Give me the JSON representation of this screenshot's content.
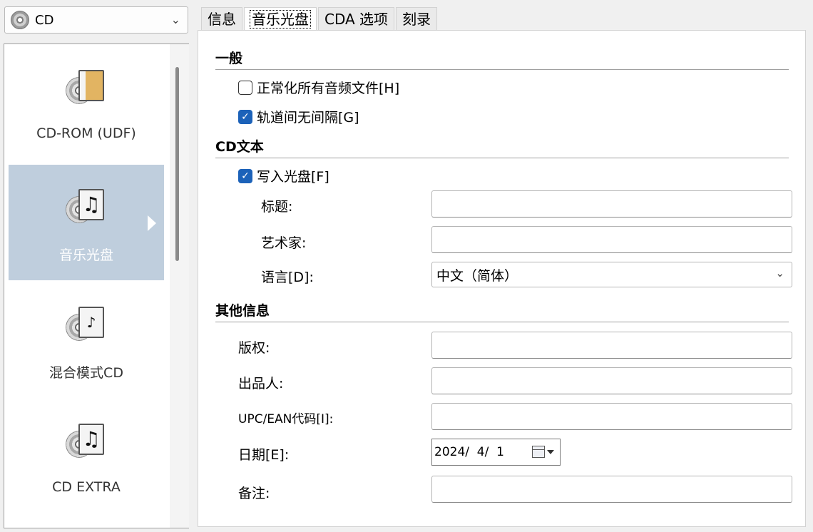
{
  "disc_select": {
    "value": "CD",
    "icon": "cd-disc-icon"
  },
  "categories": [
    {
      "label": "CD-ROM (UDF)",
      "icon": "cd-folder-icon",
      "selected": false
    },
    {
      "label": "音乐光盘",
      "icon": "cd-music-icon",
      "selected": true
    },
    {
      "label": "混合模式CD",
      "icon": "cd-mixed-icon",
      "selected": false
    },
    {
      "label": "CD EXTRA",
      "icon": "cd-extra-icon",
      "selected": false
    }
  ],
  "tabs": [
    "信息",
    "音乐光盘",
    "CDA 选项",
    "刻录"
  ],
  "active_tab": "音乐光盘",
  "general": {
    "title": "一般",
    "normalize_label": "正常化所有音频文件[H]",
    "normalize_checked": false,
    "gapless_label": "轨道间无间隔[G]",
    "gapless_checked": true
  },
  "cdtext": {
    "title": "CD文本",
    "write_label": "写入光盘[F]",
    "write_checked": true,
    "title_label": "标题:",
    "title_value": "",
    "artist_label": "艺术家:",
    "artist_value": "",
    "language_label": "语言[D]:",
    "language_value": "中文（简体）"
  },
  "other": {
    "title": "其他信息",
    "copyright_label": "版权:",
    "copyright_value": "",
    "producer_label": "出品人:",
    "producer_value": "",
    "upc_label": "UPC/EAN代码[I]:",
    "upc_value": "",
    "date_label": "日期[E]:",
    "date_value": "2024/  4/  1",
    "notes_label": "备注:",
    "notes_value": ""
  },
  "colors": {
    "selected_bg": "#bfcedd",
    "checkbox_on": "#1c62b9"
  }
}
